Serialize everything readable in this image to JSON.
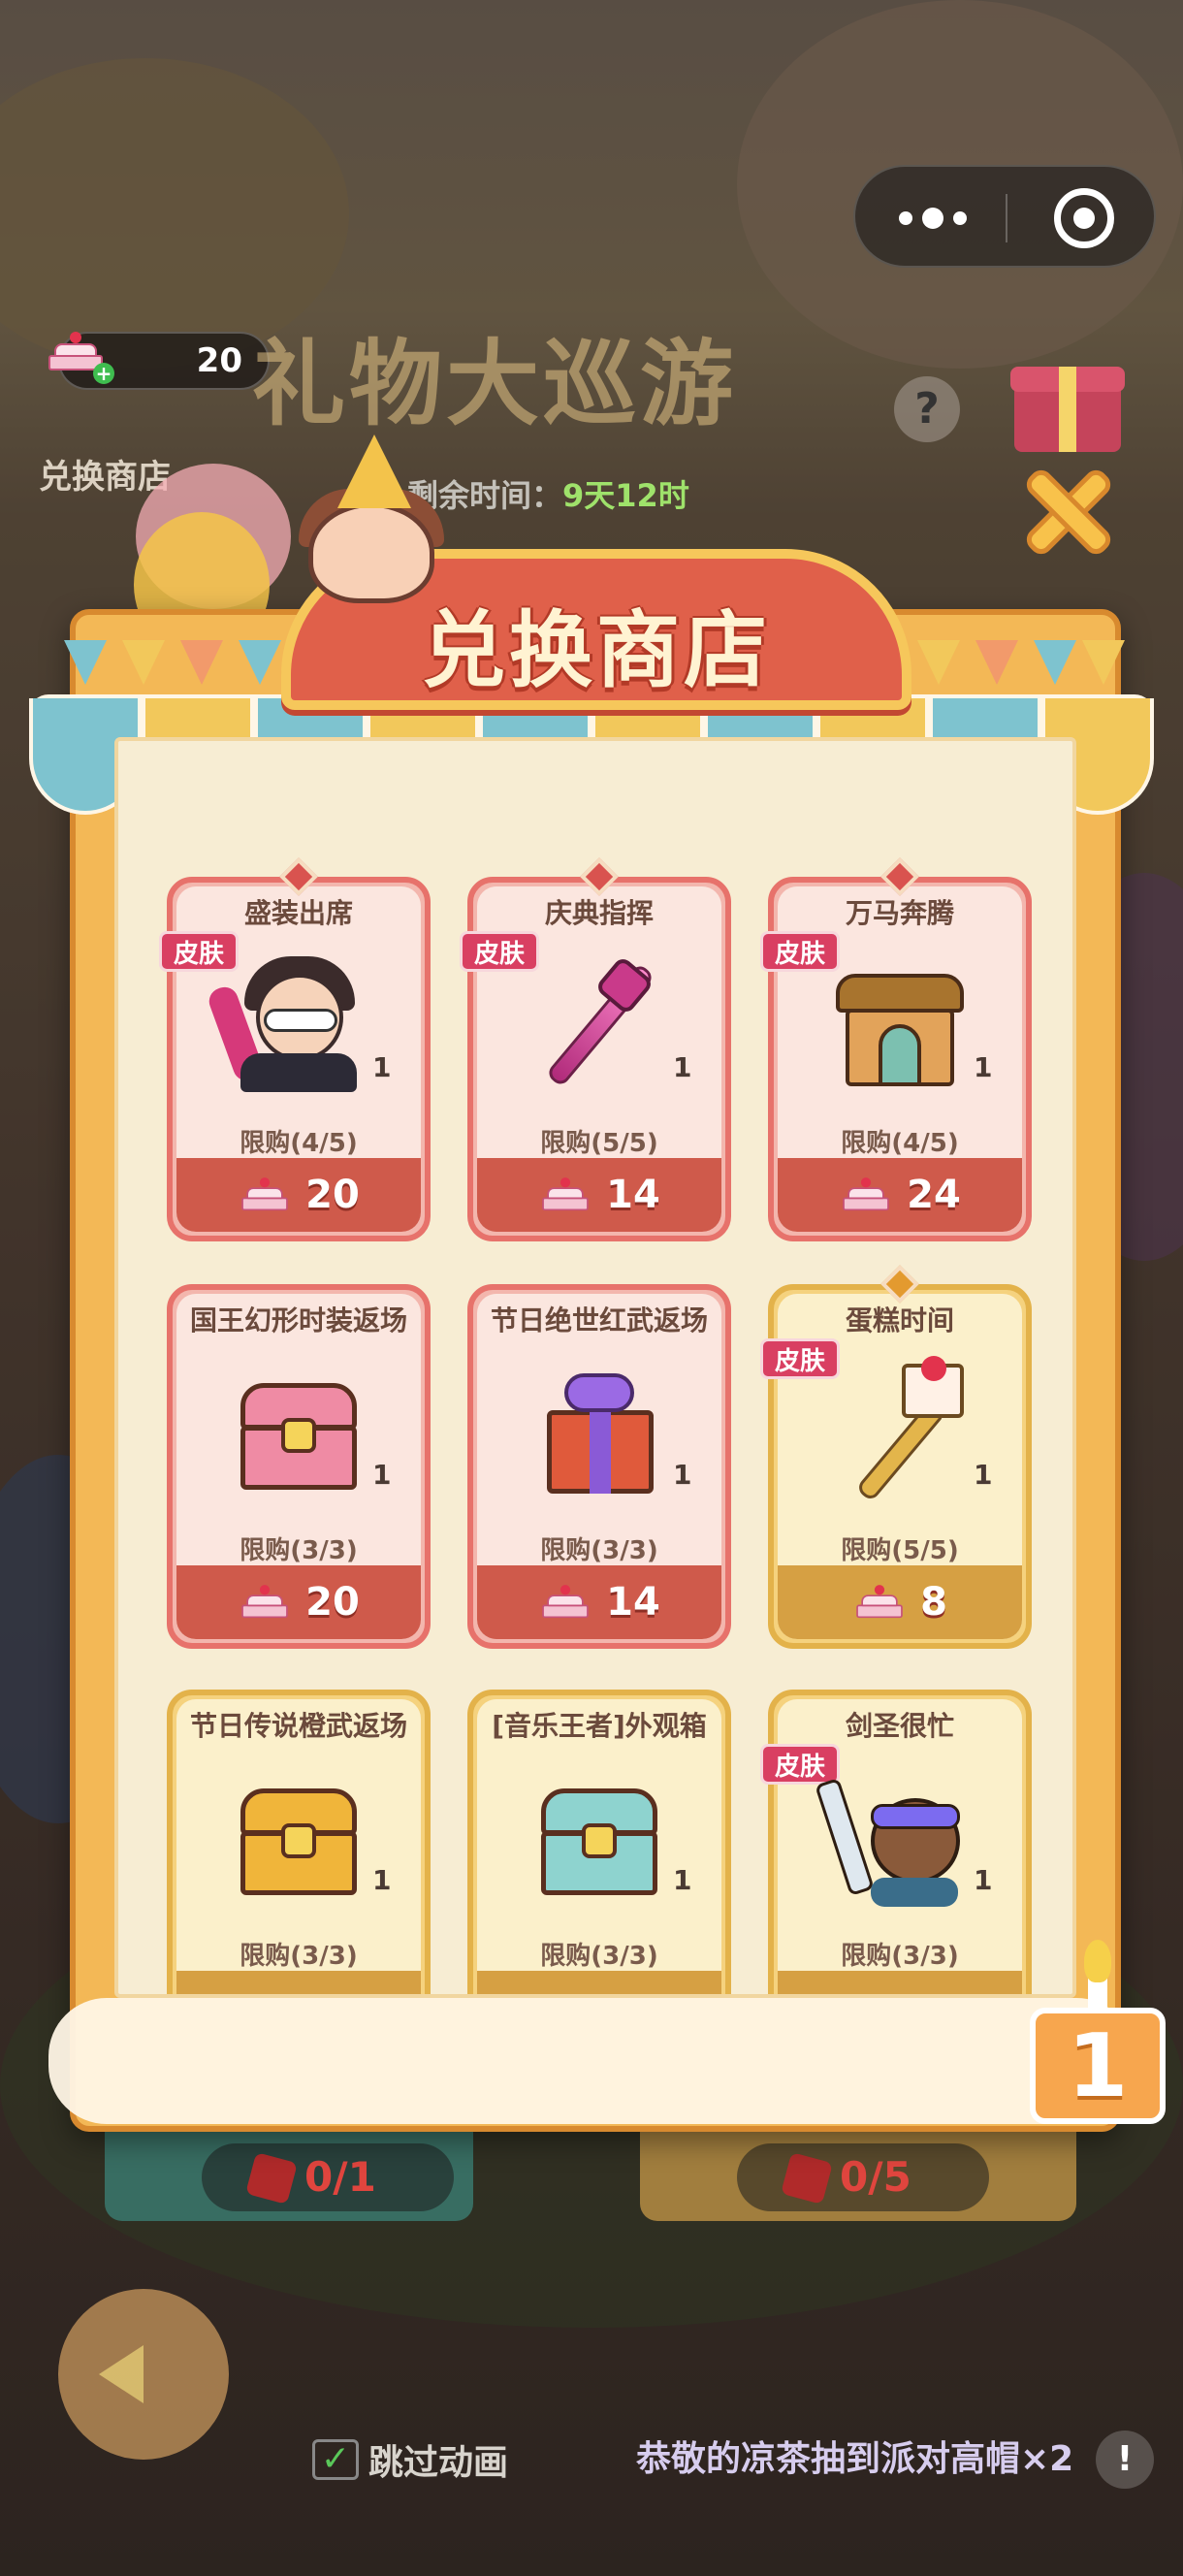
{
  "top_bar": {
    "currency_value": "20",
    "shop_label": "兑换商店",
    "event_title": "礼物大巡游",
    "timer_label": "剩余时间：",
    "timer_value": "9天12时",
    "help": "?"
  },
  "shop": {
    "title": "兑换商店",
    "skin_tag": "皮肤",
    "items": [
      {
        "name": "盛装出席",
        "tag": "皮肤",
        "qty": "1",
        "limit": "限购(4/5)",
        "price": "20",
        "style": "pink",
        "icon": "hero-skin-icon"
      },
      {
        "name": "庆典指挥",
        "tag": "皮肤",
        "qty": "1",
        "limit": "限购(5/5)",
        "price": "14",
        "style": "pink",
        "icon": "staff-skin-icon"
      },
      {
        "name": "万马奔腾",
        "tag": "皮肤",
        "qty": "1",
        "limit": "限购(4/5)",
        "price": "24",
        "style": "pink",
        "icon": "house-skin-icon"
      },
      {
        "name": "国王幻形时装返场",
        "tag": "",
        "qty": "1",
        "limit": "限购(3/3)",
        "price": "20",
        "style": "pink",
        "icon": "pink-chest-icon"
      },
      {
        "name": "节日绝世红武返场",
        "tag": "",
        "qty": "1",
        "limit": "限购(3/3)",
        "price": "14",
        "style": "pink",
        "icon": "gift-box-icon"
      },
      {
        "name": "蛋糕时间",
        "tag": "皮肤",
        "qty": "1",
        "limit": "限购(5/5)",
        "price": "8",
        "style": "gold",
        "icon": "cake-fork-icon"
      },
      {
        "name": "节日传说橙武返场",
        "tag": "",
        "qty": "1",
        "limit": "限购(3/3)",
        "price": "",
        "style": "gold",
        "icon": "gold-chest-icon"
      },
      {
        "name": "[音乐王者]外观箱",
        "tag": "",
        "qty": "1",
        "limit": "限购(3/3)",
        "price": "",
        "style": "gold",
        "icon": "teal-chest-icon"
      },
      {
        "name": "剑圣很忙",
        "tag": "皮肤",
        "qty": "1",
        "limit": "限购(3/3)",
        "price": "",
        "style": "gold",
        "icon": "sword-hero-icon"
      }
    ],
    "badge_number": "1"
  },
  "bottom": {
    "left_counter": "0/1",
    "right_counter": "0/5",
    "skip_label": "跳过动画",
    "notice": "恭敬的凉茶抽到派对高帽×2",
    "info": "!"
  },
  "colors": {
    "accent_red": "#cf5a4b",
    "accent_gold": "#d6a043",
    "skin_tag": "#d93f62",
    "timer_green": "#9fe26b"
  }
}
